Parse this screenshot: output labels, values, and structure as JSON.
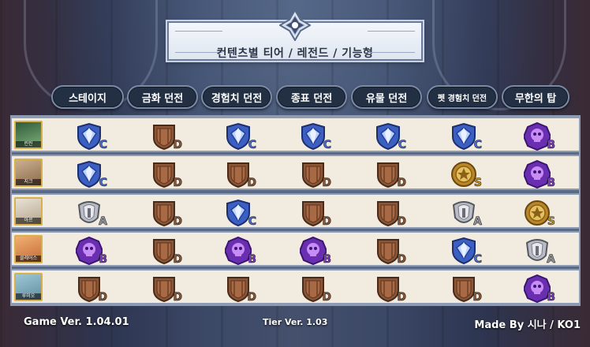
{
  "title": "컨텐츠별 티어 / 레전드 / 기능형",
  "columns": [
    "스테이지",
    "금화 던전",
    "경험치 던전",
    "종표 던전",
    "유물 던전",
    "펫 경험치 던전",
    "무한의 탑"
  ],
  "rows": [
    {
      "name": "린린",
      "grades": [
        "C",
        "D",
        "C",
        "C",
        "C",
        "C",
        "B"
      ]
    },
    {
      "name": "지크",
      "grades": [
        "C",
        "D",
        "D",
        "D",
        "D",
        "S",
        "B"
      ]
    },
    {
      "name": "아르",
      "grades": [
        "A",
        "D",
        "C",
        "D",
        "D",
        "A",
        "S"
      ]
    },
    {
      "name": "클레어스",
      "grades": [
        "B",
        "D",
        "B",
        "B",
        "D",
        "C",
        "A"
      ]
    },
    {
      "name": "루미오",
      "grades": [
        "D",
        "D",
        "D",
        "D",
        "D",
        "D",
        "B"
      ]
    }
  ],
  "footer": {
    "game_version": "Game Ver. 1.04.01",
    "tier_version": "Tier Ver. 1.03",
    "author": "Made By 시나 / KO1"
  },
  "grade_colors": {
    "S": "#c99a2e",
    "A": "#9a9aa2",
    "B": "#7b3fbd",
    "C": "#4a6fd6",
    "D": "#8a5636"
  },
  "grade_icons": {
    "S": "gold-medal-icon",
    "A": "silver-crest-icon",
    "B": "purple-skull-emblem-icon",
    "C": "blue-gem-shield-icon",
    "D": "wooden-shield-icon"
  }
}
